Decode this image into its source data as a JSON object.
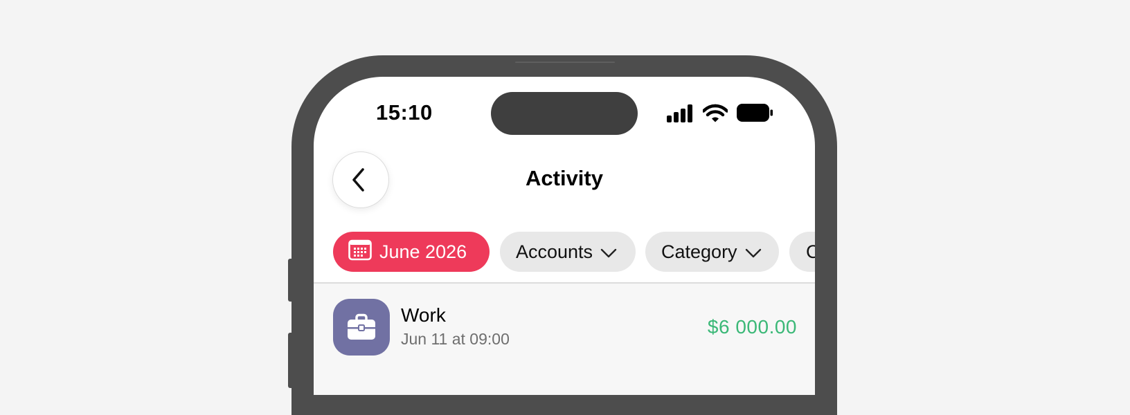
{
  "status_bar": {
    "time": "15:10",
    "icons": [
      "cellular-signal-icon",
      "wifi-icon",
      "battery-icon"
    ]
  },
  "header": {
    "title": "Activity",
    "back_icon": "chevron-left-icon"
  },
  "filters": {
    "date_chip": {
      "label": "June 2026",
      "icon": "calendar-icon",
      "color": "#ee3a5a"
    },
    "accounts_chip": {
      "label": "Accounts",
      "icon": "chevron-down-icon"
    },
    "category_chip": {
      "label": "Category",
      "icon": "chevron-down-icon"
    },
    "more_chip": {
      "label": "C"
    }
  },
  "transactions": [
    {
      "title": "Work",
      "subtitle": "Jun 11 at 09:00",
      "amount": "$6 000.00",
      "icon": "briefcase-icon",
      "icon_color": "#7171a3",
      "amount_color": "#3bb877"
    }
  ]
}
